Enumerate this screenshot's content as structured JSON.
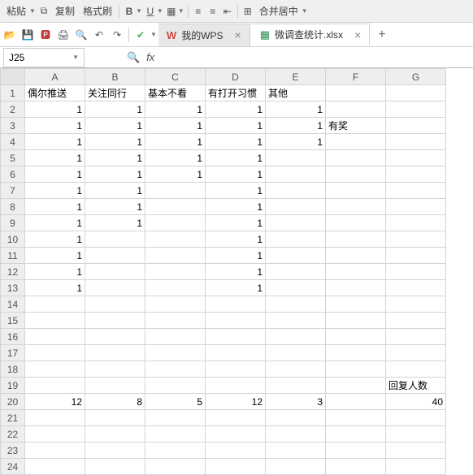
{
  "toolbar": {
    "paste_label": "粘贴",
    "copy_label": "复制",
    "format_painter_label": "格式刷",
    "merge_center_label": "合并居中"
  },
  "tabs": {
    "wps_tab": "我的WPS",
    "file_tab": "微调查统计.xlsx"
  },
  "formula_bar": {
    "cell_ref": "J25",
    "fx": "fx"
  },
  "columns": [
    "A",
    "B",
    "C",
    "D",
    "E",
    "F",
    "G"
  ],
  "headers": {
    "A": "偶尔推送",
    "B": "关注同行",
    "C": "基本不看",
    "D": "有打开习惯",
    "E": "其他",
    "F": "",
    "G": ""
  },
  "rows": [
    {
      "n": 1,
      "A": "偶尔推送",
      "B": "关注同行",
      "C": "基本不看",
      "D": "有打开习惯",
      "E": "其他",
      "F": "",
      "G": "",
      "txt": true
    },
    {
      "n": 2,
      "A": 1,
      "B": 1,
      "C": 1,
      "D": 1,
      "E": 1,
      "F": "",
      "G": ""
    },
    {
      "n": 3,
      "A": 1,
      "B": 1,
      "C": 1,
      "D": 1,
      "E": 1,
      "F": "有奖",
      "G": "",
      "Ftxt": true
    },
    {
      "n": 4,
      "A": 1,
      "B": 1,
      "C": 1,
      "D": 1,
      "E": 1,
      "F": "",
      "G": ""
    },
    {
      "n": 5,
      "A": 1,
      "B": 1,
      "C": 1,
      "D": 1,
      "E": "",
      "F": "",
      "G": ""
    },
    {
      "n": 6,
      "A": 1,
      "B": 1,
      "C": 1,
      "D": 1,
      "E": "",
      "F": "",
      "G": ""
    },
    {
      "n": 7,
      "A": 1,
      "B": 1,
      "C": "",
      "D": 1,
      "E": "",
      "F": "",
      "G": ""
    },
    {
      "n": 8,
      "A": 1,
      "B": 1,
      "C": "",
      "D": 1,
      "E": "",
      "F": "",
      "G": ""
    },
    {
      "n": 9,
      "A": 1,
      "B": 1,
      "C": "",
      "D": 1,
      "E": "",
      "F": "",
      "G": ""
    },
    {
      "n": 10,
      "A": 1,
      "B": "",
      "C": "",
      "D": 1,
      "E": "",
      "F": "",
      "G": ""
    },
    {
      "n": 11,
      "A": 1,
      "B": "",
      "C": "",
      "D": 1,
      "E": "",
      "F": "",
      "G": ""
    },
    {
      "n": 12,
      "A": 1,
      "B": "",
      "C": "",
      "D": 1,
      "E": "",
      "F": "",
      "G": ""
    },
    {
      "n": 13,
      "A": 1,
      "B": "",
      "C": "",
      "D": 1,
      "E": "",
      "F": "",
      "G": ""
    },
    {
      "n": 14,
      "A": "",
      "B": "",
      "C": "",
      "D": "",
      "E": "",
      "F": "",
      "G": ""
    },
    {
      "n": 15,
      "A": "",
      "B": "",
      "C": "",
      "D": "",
      "E": "",
      "F": "",
      "G": ""
    },
    {
      "n": 16,
      "A": "",
      "B": "",
      "C": "",
      "D": "",
      "E": "",
      "F": "",
      "G": ""
    },
    {
      "n": 17,
      "A": "",
      "B": "",
      "C": "",
      "D": "",
      "E": "",
      "F": "",
      "G": ""
    },
    {
      "n": 18,
      "A": "",
      "B": "",
      "C": "",
      "D": "",
      "E": "",
      "F": "",
      "G": ""
    },
    {
      "n": 19,
      "A": "",
      "B": "",
      "C": "",
      "D": "",
      "E": "",
      "F": "",
      "G": "回复人数",
      "Gtxt": true
    },
    {
      "n": 20,
      "A": 12,
      "B": 8,
      "C": 5,
      "D": 12,
      "E": 3,
      "F": "",
      "G": 40
    },
    {
      "n": 21,
      "A": "",
      "B": "",
      "C": "",
      "D": "",
      "E": "",
      "F": "",
      "G": ""
    },
    {
      "n": 22,
      "A": "",
      "B": "",
      "C": "",
      "D": "",
      "E": "",
      "F": "",
      "G": ""
    },
    {
      "n": 23,
      "A": "",
      "B": "",
      "C": "",
      "D": "",
      "E": "",
      "F": "",
      "G": ""
    },
    {
      "n": 24,
      "A": "",
      "B": "",
      "C": "",
      "D": "",
      "E": "",
      "F": "",
      "G": ""
    }
  ],
  "chart_data": {
    "type": "table",
    "title": "微调查统计",
    "categories": [
      "偶尔推送",
      "关注同行",
      "基本不看",
      "有打开习惯",
      "其他"
    ],
    "values": [
      12,
      8,
      5,
      12,
      3
    ],
    "total_label": "回复人数",
    "total": 40
  }
}
